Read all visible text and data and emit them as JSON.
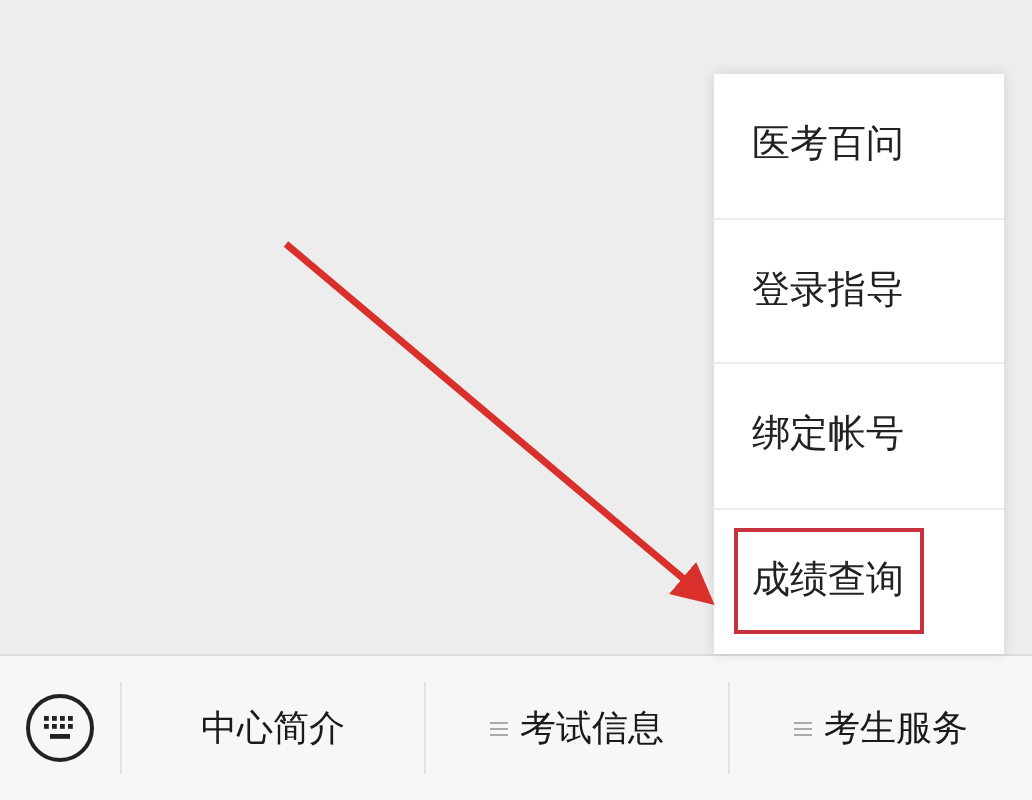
{
  "popup_menu": {
    "items": [
      {
        "label": "医考百问",
        "highlighted": false
      },
      {
        "label": "登录指导",
        "highlighted": false
      },
      {
        "label": "绑定帐号",
        "highlighted": false
      },
      {
        "label": "成绩查询",
        "highlighted": true
      }
    ]
  },
  "bottom_menu": {
    "tabs": [
      {
        "label": "中心简介",
        "submenu": false
      },
      {
        "label": "考试信息",
        "submenu": true
      },
      {
        "label": "考生服务",
        "submenu": true
      }
    ]
  }
}
